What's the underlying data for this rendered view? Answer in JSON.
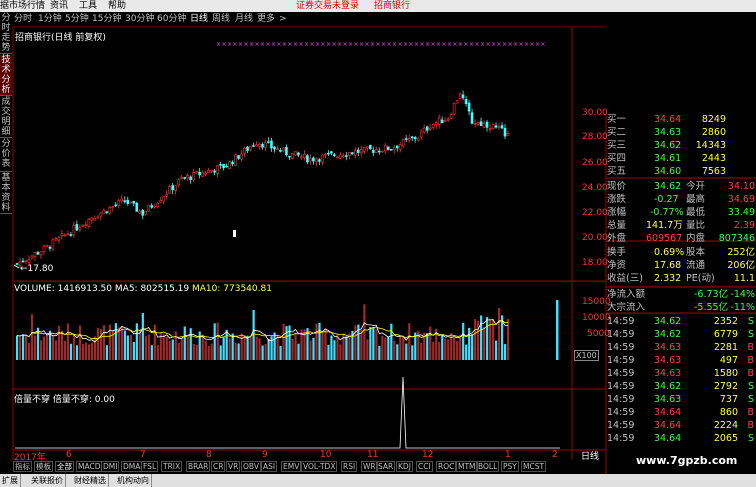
{
  "menubar": {
    "items": [
      "据市场行情",
      "资讯",
      "工具",
      "帮助"
    ],
    "notice": "证券交易未登录",
    "stock": "招商银行"
  },
  "period_bar": [
    "分时",
    "1分钟",
    "5分钟",
    "15分钟",
    "30分钟",
    "60分钟",
    "日线",
    "周线",
    "月线",
    "更多",
    ">"
  ],
  "vertical_tabs": [
    "分时走势",
    "技术分析",
    "成交明细",
    "分价表",
    "基本资料"
  ],
  "chart": {
    "title": "招商银行(日线 前复权)",
    "low_marker": "←17.80",
    "y_axis": [
      "28.00",
      "26.00",
      "24.00",
      "22.00",
      "20.00",
      "18.00"
    ],
    "y_axis_top": "30.00",
    "x_axis": [
      "2017年",
      "6",
      "7",
      "8",
      "9",
      "10",
      "11",
      "12",
      "1",
      "2"
    ]
  },
  "volume": {
    "label": "VOLUME:",
    "volume": "1416913.50",
    "ma5_label": "MA5:",
    "ma5": "802515.19",
    "ma10_label": "MA10:",
    "ma10": "773540.81",
    "y_axis": [
      "15000",
      "10000",
      "5000",
      "X100"
    ]
  },
  "indicator": {
    "text": "倍量不穿  倍量不穿: 0.00"
  },
  "quote": {
    "buy": [
      {
        "label": "买一",
        "price": "34.64",
        "vol": "8249"
      },
      {
        "label": "买二",
        "price": "34.63",
        "vol": "2860"
      },
      {
        "label": "买三",
        "price": "34.62",
        "vol": "14343"
      },
      {
        "label": "买四",
        "price": "34.61",
        "vol": "2443"
      },
      {
        "label": "买五",
        "price": "34.60",
        "vol": "7563"
      }
    ],
    "stats": [
      {
        "l1": "现价",
        "v1": "34.62",
        "l2": "今开",
        "v2": "34.10"
      },
      {
        "l1": "涨跌",
        "v1": "-0.27",
        "l2": "最高",
        "v2": "34.69"
      },
      {
        "l1": "涨幅",
        "v1": "-0.77%",
        "l2": "最低",
        "v2": "33.49"
      },
      {
        "l1": "总量",
        "v1": "141.7万",
        "l2": "量比",
        "v2": "2.39"
      },
      {
        "l1": "外盘",
        "v1": "609567",
        "l2": "内盘",
        "v2": "807346"
      }
    ],
    "stats2": [
      {
        "l1": "换手",
        "v1": "0.69%",
        "l2": "股本",
        "v2": "252亿"
      },
      {
        "l1": "净资",
        "v1": "17.68",
        "l2": "流通",
        "v2": "206亿"
      },
      {
        "l1": "收益(三)",
        "v1": "2.332",
        "l2": "PE(动)",
        "v2": "11.1"
      }
    ],
    "flows": [
      {
        "label": "净流入额",
        "v1": "-6.73亿",
        "v2": "-14%"
      },
      {
        "label": "大宗流入",
        "v1": "-5.55亿",
        "v2": "-11%"
      }
    ],
    "ticks": [
      {
        "time": "14:59",
        "price": "34.62",
        "vol": "2352",
        "side": "S"
      },
      {
        "time": "14:59",
        "price": "34.62",
        "vol": "6779",
        "side": "S"
      },
      {
        "time": "14:59",
        "price": "34.63",
        "vol": "2281",
        "side": "B"
      },
      {
        "time": "14:59",
        "price": "34.63",
        "vol": "497",
        "side": "B"
      },
      {
        "time": "14:59",
        "price": "34.63",
        "vol": "1580",
        "side": "B"
      },
      {
        "time": "14:59",
        "price": "34.62",
        "vol": "2792",
        "side": "S"
      },
      {
        "time": "14:59",
        "price": "34.63",
        "vol": "737",
        "side": "S"
      },
      {
        "time": "14:59",
        "price": "34.64",
        "vol": "860",
        "side": "B"
      },
      {
        "time": "14:59",
        "price": "34.64",
        "vol": "2224",
        "side": "B"
      },
      {
        "time": "14:59",
        "price": "34.64",
        "vol": "2065",
        "side": "S"
      }
    ]
  },
  "indicator_tabs": [
    "指标",
    "模板",
    "全部",
    "MACD",
    "DMI",
    "DMA",
    "FSL",
    "TRIX",
    "BRAR",
    "CR",
    "VR",
    "OBV",
    "ASI",
    "EMV",
    "VOL-TDX",
    "RSI",
    "WR",
    "SAR",
    "KDJ",
    "CCI",
    "ROC",
    "MTM",
    "BOLL",
    "PSY",
    "MCST"
  ],
  "bottom_tabs": [
    "扩展",
    "关联报价",
    "财经精选",
    "机构动向"
  ],
  "day_line_label": "日线",
  "watermark": "www.7gpzb.com",
  "colors": {
    "up": "#ff3030",
    "down": "#40ffff",
    "ma5": "#ffffff",
    "ma10": "#ffff00",
    "background": "#000000"
  }
}
